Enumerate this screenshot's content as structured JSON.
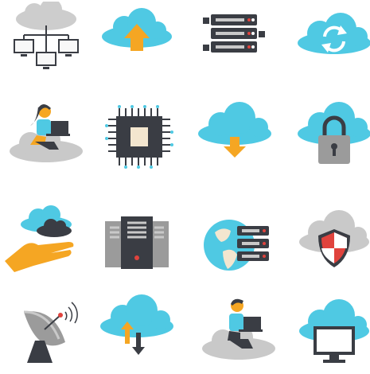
{
  "icons": [
    {
      "name": "cloud-network-icon"
    },
    {
      "name": "cloud-upload-icon"
    },
    {
      "name": "server-rack-icon"
    },
    {
      "name": "cloud-sync-icon"
    },
    {
      "name": "woman-laptop-on-cloud-icon"
    },
    {
      "name": "microchip-icon"
    },
    {
      "name": "cloud-download-icon"
    },
    {
      "name": "cloud-lock-icon"
    },
    {
      "name": "hand-holding-clouds-icon"
    },
    {
      "name": "server-towers-icon"
    },
    {
      "name": "globe-server-icon"
    },
    {
      "name": "cloud-shield-icon"
    },
    {
      "name": "satellite-dish-icon"
    },
    {
      "name": "cloud-upload-download-icon"
    },
    {
      "name": "man-laptop-on-cloud-icon"
    },
    {
      "name": "cloud-monitor-icon"
    }
  ],
  "colors": {
    "cloud_blue": "#4fc9e3",
    "cloud_gray": "#c9c9c9",
    "dark_gray": "#3a3d44",
    "orange": "#f5a623",
    "red": "#e0433d",
    "light_gray": "#e8e8e8"
  }
}
